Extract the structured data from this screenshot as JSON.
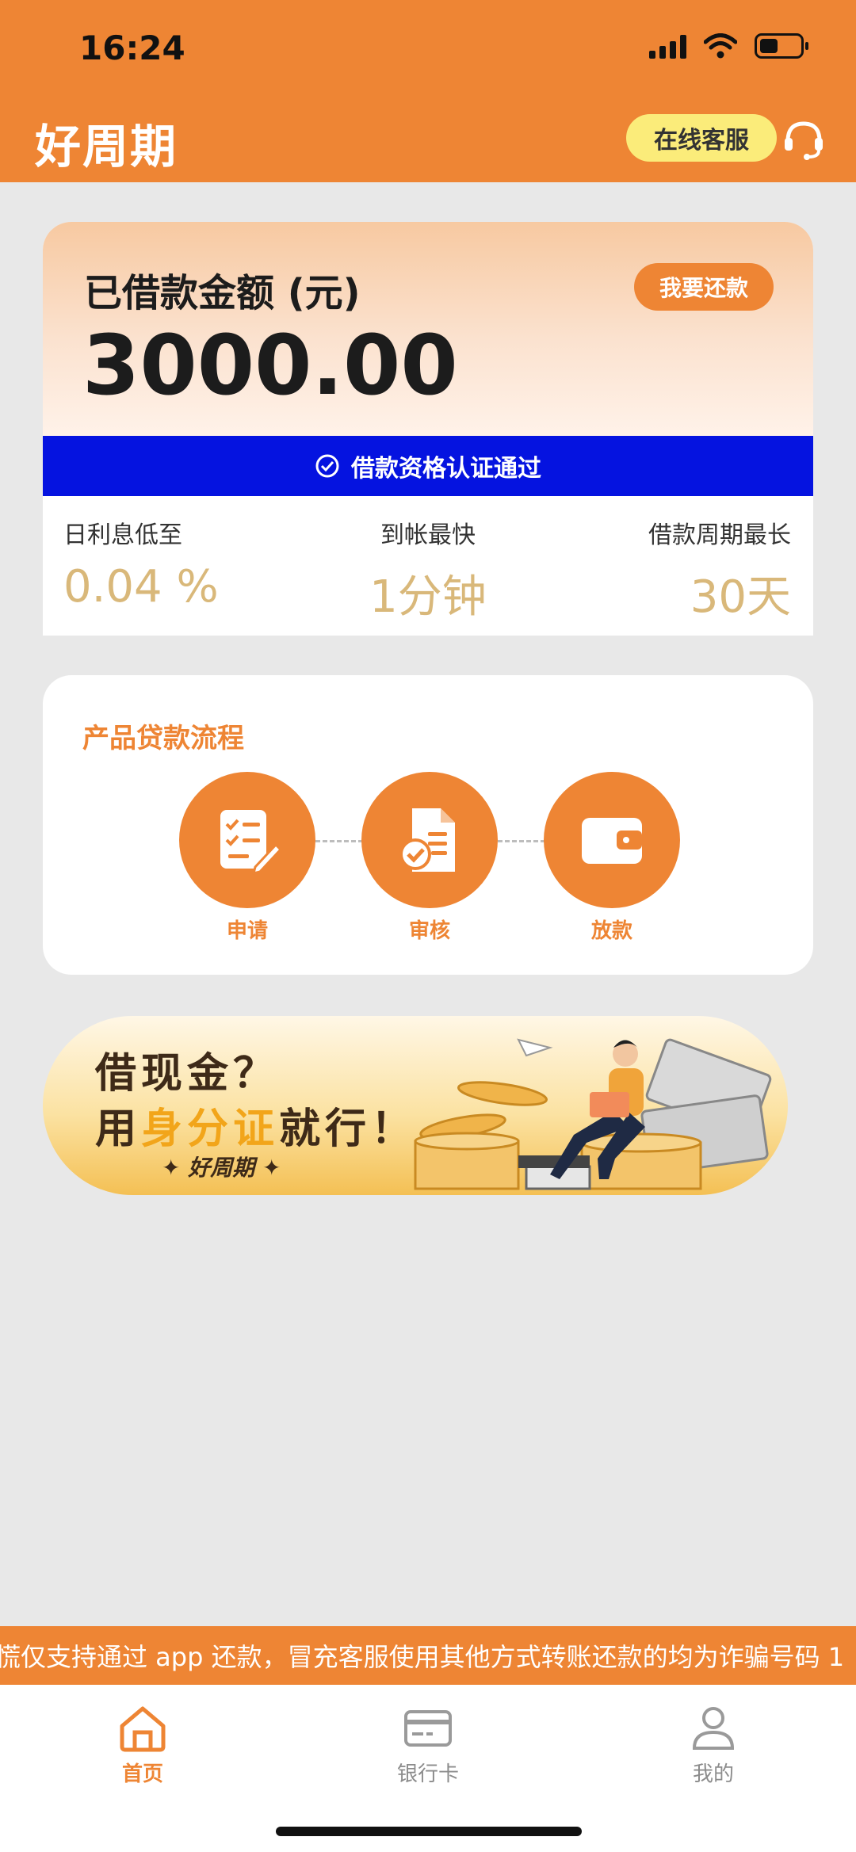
{
  "status_bar": {
    "time": "16:24"
  },
  "header": {
    "title": "好周期",
    "customer_service_label": "在线客服"
  },
  "loan_card": {
    "label": "已借款金额 (元)",
    "amount": "3000.00",
    "repay_label": "我要还款",
    "verify_text": "借款资格认证通过",
    "stats": [
      {
        "label": "日利息低至",
        "value": "0.04 %"
      },
      {
        "label": "到帐最快",
        "value": "1分钟"
      },
      {
        "label": "借款周期最长",
        "value": "30天"
      }
    ]
  },
  "process": {
    "title": "产品贷款流程",
    "steps": [
      {
        "label": "申请",
        "icon": "checklist-icon"
      },
      {
        "label": "审核",
        "icon": "document-check-icon"
      },
      {
        "label": "放款",
        "icon": "wallet-icon"
      }
    ]
  },
  "banner": {
    "line1": "借现金？",
    "line2_a": "用",
    "line2_b": "身分证",
    "line2_c": "就行！",
    "brand": "✦ 好周期 ✦"
  },
  "notice": "慌仅支持通过 app 还款，冒充客服使用其他方式转账还款的均为诈骗号码 1",
  "bottom_nav": [
    {
      "label": "首页",
      "icon": "home-icon",
      "active": true
    },
    {
      "label": "银行卡",
      "icon": "bank-card-icon",
      "active": false
    },
    {
      "label": "我的",
      "icon": "user-icon",
      "active": false
    }
  ],
  "colors": {
    "primary": "#ee8534",
    "verify_bar": "#0513e0",
    "cs_button": "#fbec7a",
    "stat_value": "#d9b87a"
  }
}
